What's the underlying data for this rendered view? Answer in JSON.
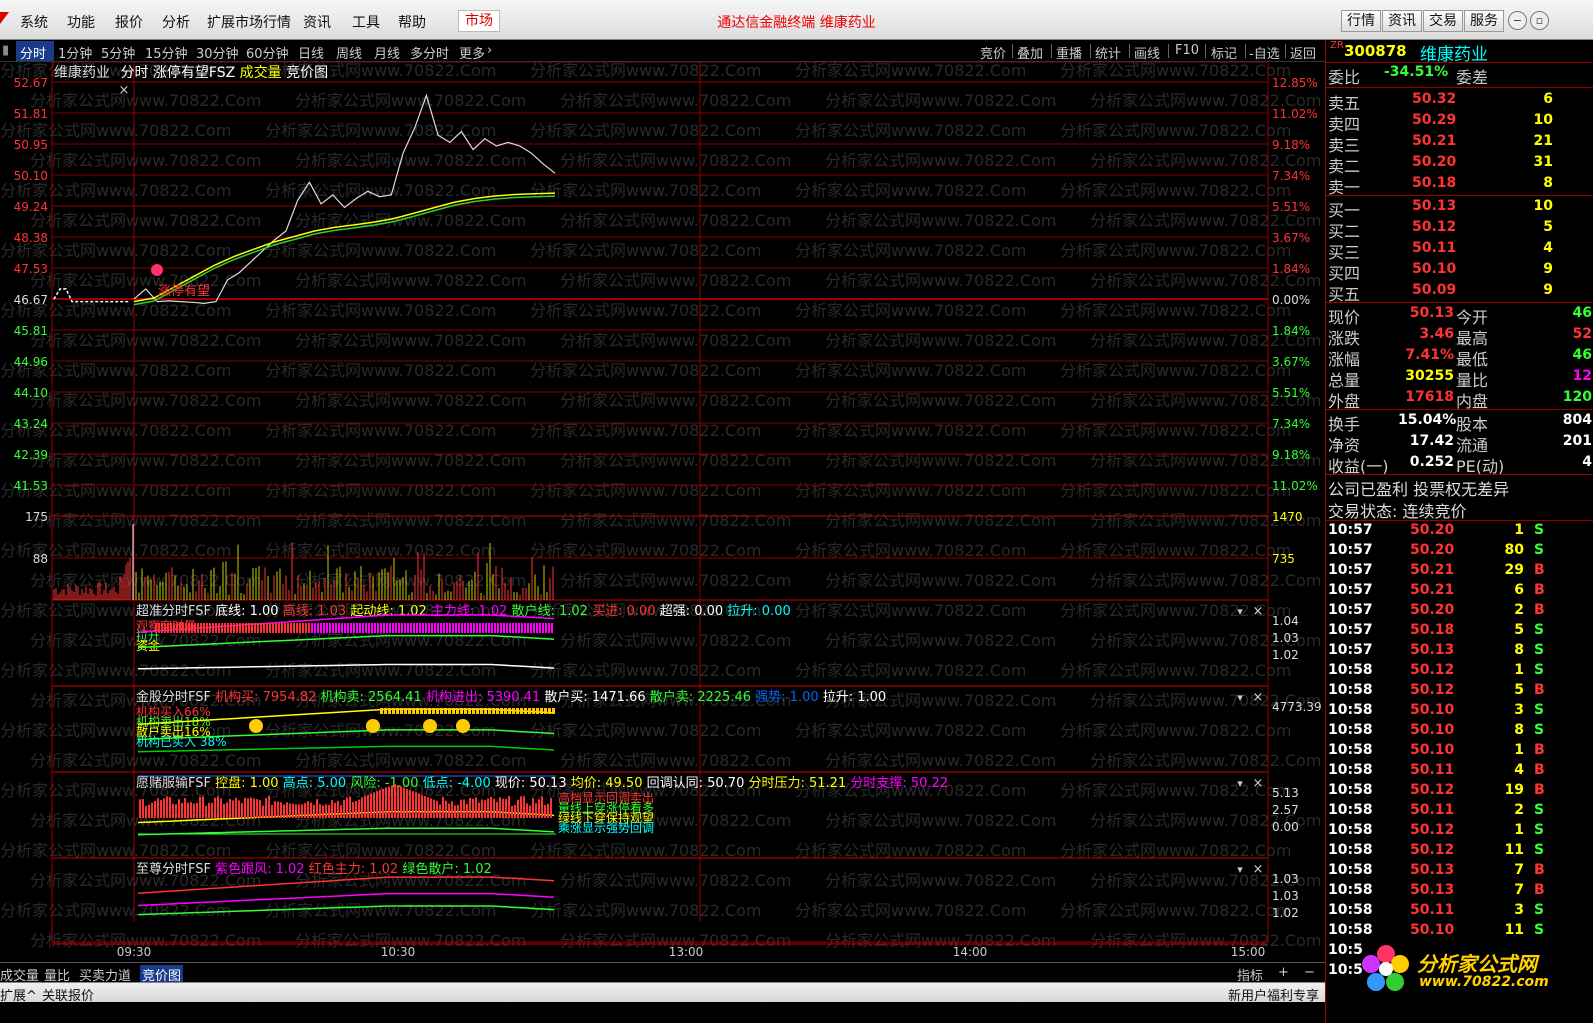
{
  "menubar": {
    "items": [
      "系统",
      "功能",
      "报价",
      "分析",
      "扩展市场行情",
      "资讯",
      "工具",
      "帮助"
    ],
    "market": "市场",
    "title": "通达信金融终端  维康药业",
    "right_buttons": [
      "行情",
      "资讯",
      "交易",
      "服务"
    ]
  },
  "toolbar": {
    "periods": [
      "分时",
      "1分钟",
      "5分钟",
      "15分钟",
      "30分钟",
      "60分钟",
      "日线",
      "周线",
      "月线",
      "多分时",
      "更多"
    ],
    "right_tools": [
      "竞价",
      "叠加",
      "重播",
      "统计",
      "画线",
      "F10",
      "标记",
      "-自选",
      "返回"
    ]
  },
  "chart_header": {
    "name": "维康药业",
    "mode": "分时",
    "indicator": "涨停有望FSZ",
    "vol": "成交量",
    "auction": "竞价图"
  },
  "chart_data": {
    "type": "line",
    "price_ticks": [
      "52.67",
      "51.81",
      "50.95",
      "50.10",
      "49.24",
      "48.38",
      "47.53",
      "46.67",
      "45.81",
      "44.96",
      "44.10",
      "43.24",
      "42.39",
      "41.53"
    ],
    "pct_ticks": [
      "12.85%",
      "11.02%",
      "9.18%",
      "7.34%",
      "5.51%",
      "3.67%",
      "1.84%",
      "0.00%",
      "1.84%",
      "3.67%",
      "5.51%",
      "7.34%",
      "9.18%",
      "11.02%"
    ],
    "vol_ticks_left": [
      "175",
      "88"
    ],
    "vol_ticks_right": [
      "1470",
      "735"
    ],
    "time_labels": [
      "09:30",
      "10:30",
      "13:00",
      "14:00",
      "15:00"
    ],
    "price_series": [
      46.67,
      46.95,
      46.6,
      46.62,
      46.6,
      46.58,
      46.55,
      46.6,
      47.2,
      47.4,
      47.7,
      48.0,
      48.3,
      48.55,
      49.4,
      49.9,
      49.3,
      49.55,
      49.2,
      49.45,
      49.65,
      49.5,
      49.55,
      50.7,
      51.4,
      52.3,
      51.2,
      51.0,
      51.3,
      50.8,
      51.1,
      50.9,
      51.0,
      50.9,
      50.7,
      50.4,
      50.15
    ],
    "avg_series": [
      46.6,
      46.7,
      47.0,
      47.3,
      47.6,
      47.85,
      48.05,
      48.25,
      48.4,
      48.55,
      48.65,
      48.72,
      48.8,
      48.9,
      49.05,
      49.2,
      49.35,
      49.45,
      49.52,
      49.56,
      49.58,
      49.6
    ],
    "signal_label": "涨停有望"
  },
  "indicators": [
    {
      "name": "超准分时FSF",
      "fields": [
        [
          "底线:",
          "1.00",
          "#fff"
        ],
        [
          "高线:",
          "1.03",
          "#f33"
        ],
        [
          "起动线:",
          "1.02",
          "#ff0"
        ],
        [
          "主力线:",
          "1.02",
          "#f0f"
        ],
        [
          "散户线:",
          "1.02",
          "#3f3"
        ],
        [
          "买进:",
          "0.00",
          "#f33"
        ],
        [
          "超强:",
          "0.00",
          "#fff"
        ],
        [
          "拉升:",
          "0.00",
          "#0ff"
        ]
      ],
      "right_ticks": [
        "1.04",
        "1.03",
        "1.02"
      ],
      "notes": [
        "观察穿时量",
        "拉升",
        "资金"
      ]
    },
    {
      "name": "金股分时FSF",
      "fields": [
        [
          "机构买:",
          "7954.82",
          "#f33"
        ],
        [
          "机构卖:",
          "2564.41",
          "#3f3"
        ],
        [
          "机构进出:",
          "5390.41",
          "#f0f"
        ],
        [
          "散户买:",
          "1471.66",
          "#fff"
        ],
        [
          "散户卖:",
          "2225.46",
          "#3f3"
        ],
        [
          "强势:",
          "1.00",
          "#06f"
        ],
        [
          "拉升:",
          "1.00",
          "#fff"
        ]
      ],
      "right_ticks": [
        "4773.39"
      ],
      "notes": [
        "机构买入66%",
        "机构卖出18%",
        "散户卖出16%",
        "机构已买入 38%"
      ]
    },
    {
      "name": "愿赌服输FSF",
      "fields": [
        [
          "控盘:",
          "1.00",
          "#ff0"
        ],
        [
          "高点:",
          "5.00",
          "#0ff"
        ],
        [
          "风险:",
          "-1.00",
          "#3f3"
        ],
        [
          "低点:",
          "-4.00",
          "#0ff"
        ],
        [
          "现价:",
          "50.13",
          "#fff"
        ],
        [
          "均价:",
          "49.50",
          "#ff0"
        ],
        [
          "回调认同:",
          "50.70",
          "#fff"
        ],
        [
          "分时压力:",
          "51.21",
          "#ff0"
        ],
        [
          "分时支撑:",
          "50.22",
          "#f0f"
        ]
      ],
      "right_ticks": [
        "5.13",
        "2.57",
        "0.00"
      ],
      "notes": [
        "高档显示回调卖出",
        "量线上穿涨停看多",
        "绿线下穿保持观望",
        "乘涨显示强势回调"
      ]
    },
    {
      "name": "至尊分时FSF",
      "fields": [
        [
          "紫色跟风:",
          "1.02",
          "#f0f"
        ],
        [
          "红色主力:",
          "1.02",
          "#f33"
        ],
        [
          "绿色散户:",
          "1.02",
          "#3f3"
        ]
      ],
      "right_ticks": [
        "1.03",
        "1.03",
        "1.02"
      ],
      "notes": []
    }
  ],
  "quote": {
    "code": "300878",
    "name": "维康药业",
    "badge": "ZR",
    "weibi_label": "委比",
    "weibi": "-34.51%",
    "weicha_label": "委差",
    "asks": [
      [
        "卖五",
        "50.32",
        "6"
      ],
      [
        "卖四",
        "50.29",
        "10"
      ],
      [
        "卖三",
        "50.21",
        "21"
      ],
      [
        "卖二",
        "50.20",
        "31"
      ],
      [
        "卖一",
        "50.18",
        "8"
      ]
    ],
    "bids": [
      [
        "买一",
        "50.13",
        "10"
      ],
      [
        "买二",
        "50.12",
        "5"
      ],
      [
        "买三",
        "50.11",
        "4"
      ],
      [
        "买四",
        "50.10",
        "9"
      ],
      [
        "买五",
        "50.09",
        "9"
      ]
    ],
    "stats": [
      [
        "现价",
        "50.13",
        "今开",
        "46"
      ],
      [
        "涨跌",
        "3.46",
        "最高",
        "52"
      ],
      [
        "涨幅",
        "7.41%",
        "最低",
        "46"
      ],
      [
        "总量",
        "30255",
        "量比",
        "12"
      ],
      [
        "外盘",
        "17618",
        "内盘",
        "120"
      ]
    ],
    "stats2": [
      [
        "换手",
        "15.04%",
        "股本",
        "804"
      ],
      [
        "净资",
        "17.42",
        "流通",
        "201"
      ],
      [
        "收益(一)",
        "0.252",
        "PE(动)",
        "4"
      ]
    ],
    "note1": "公司已盈利 投票权无差异",
    "note2": "交易状态: 连续竞价",
    "ticks": [
      [
        "10:57",
        "50.20",
        "1",
        "S"
      ],
      [
        "10:57",
        "50.20",
        "80",
        "S"
      ],
      [
        "10:57",
        "50.21",
        "29",
        "B"
      ],
      [
        "10:57",
        "50.21",
        "6",
        "B"
      ],
      [
        "10:57",
        "50.20",
        "2",
        "B"
      ],
      [
        "10:57",
        "50.18",
        "5",
        "S"
      ],
      [
        "10:57",
        "50.13",
        "8",
        "S"
      ],
      [
        "10:58",
        "50.12",
        "1",
        "S"
      ],
      [
        "10:58",
        "50.12",
        "5",
        "B"
      ],
      [
        "10:58",
        "50.10",
        "3",
        "S"
      ],
      [
        "10:58",
        "50.10",
        "8",
        "S"
      ],
      [
        "10:58",
        "50.10",
        "1",
        "B"
      ],
      [
        "10:58",
        "50.11",
        "4",
        "B"
      ],
      [
        "10:58",
        "50.12",
        "19",
        "B"
      ],
      [
        "10:58",
        "50.11",
        "2",
        "S"
      ],
      [
        "10:58",
        "50.12",
        "1",
        "S"
      ],
      [
        "10:58",
        "50.12",
        "11",
        "S"
      ],
      [
        "10:58",
        "50.13",
        "7",
        "B"
      ],
      [
        "10:58",
        "50.13",
        "7",
        "B"
      ],
      [
        "10:58",
        "50.11",
        "3",
        "S"
      ],
      [
        "10:58",
        "50.10",
        "11",
        "S"
      ],
      [
        "10:5",
        "",
        "",
        " "
      ],
      [
        "10:5",
        "",
        "",
        ""
      ]
    ]
  },
  "bottom_tabs": [
    "成交量",
    "量比",
    "买卖力道",
    "竞价图"
  ],
  "bottom_right": [
    "指标",
    "+",
    "−"
  ],
  "status": {
    "left": "扩展^",
    "left2": "关联报价",
    "right": "新用户福利专享"
  },
  "brand": {
    "name": "分析家公式网",
    "url": "www.70822.com"
  },
  "watermark": "分析家公式网www.70822.Com"
}
